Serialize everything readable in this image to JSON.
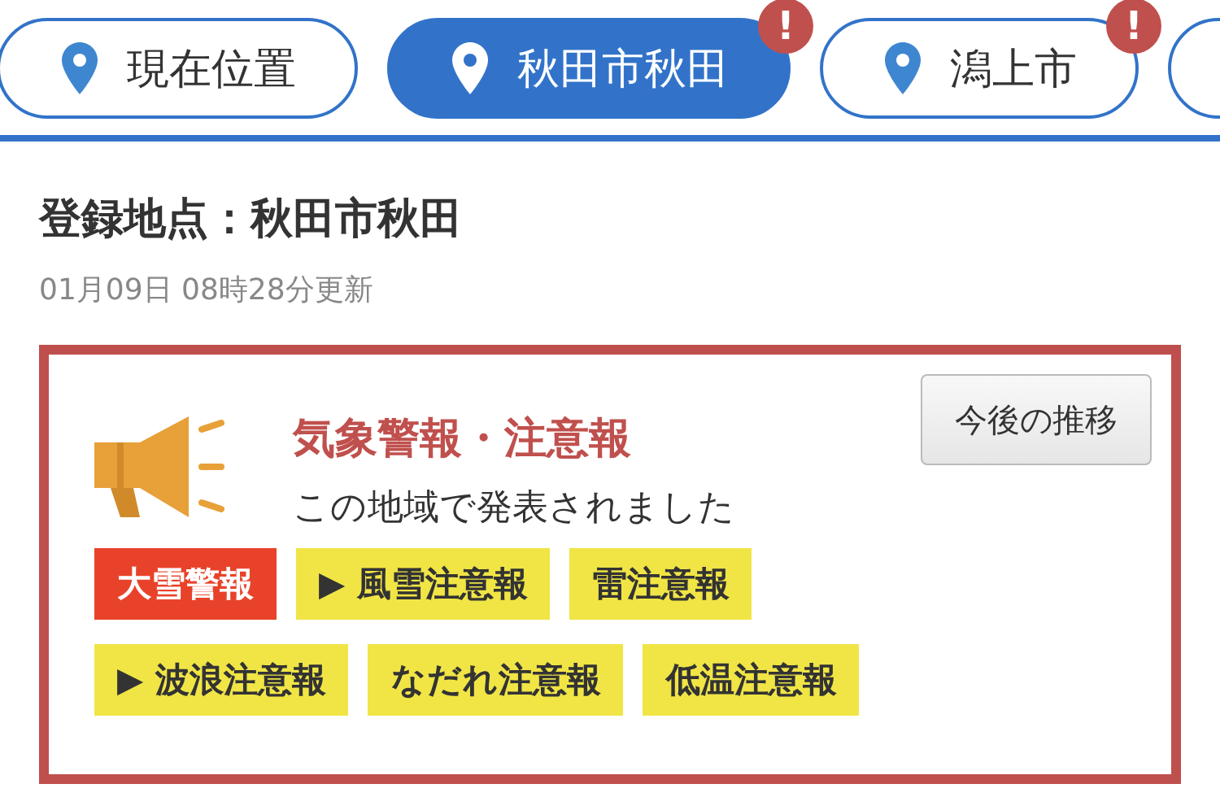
{
  "tabs": [
    {
      "label": "現在位置",
      "selected": false,
      "alert": false
    },
    {
      "label": "秋田市秋田",
      "selected": true,
      "alert": true,
      "alert_mark": "!"
    },
    {
      "label": "潟上市",
      "selected": false,
      "alert": true,
      "alert_mark": "!"
    },
    {
      "selected": false,
      "alert": false
    }
  ],
  "location": {
    "title": "登録地点：秋田市秋田",
    "updated": "01月09日 08時28分更新"
  },
  "alert_card": {
    "heading": "気象警報・注意報",
    "message": "この地域で発表されました",
    "trend_button": "今後の推移",
    "items": [
      {
        "label": "大雪警報",
        "kind": "warning"
      },
      {
        "label": "▶ 風雪注意報",
        "kind": "advisory"
      },
      {
        "label": "雷注意報",
        "kind": "advisory"
      },
      {
        "label": "▶ 波浪注意報",
        "kind": "advisory"
      },
      {
        "label": "なだれ注意報",
        "kind": "advisory"
      },
      {
        "label": "低温注意報",
        "kind": "advisory"
      }
    ]
  }
}
